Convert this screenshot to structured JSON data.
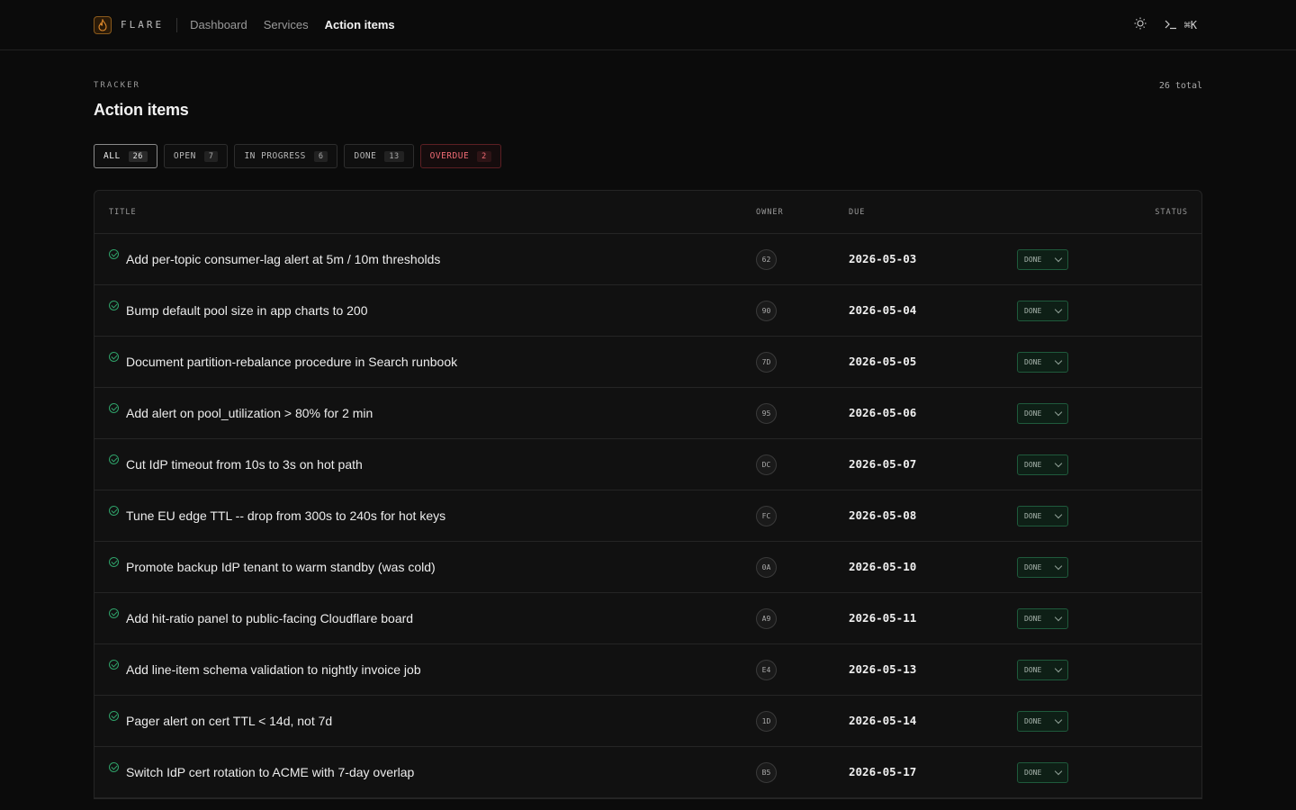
{
  "app": {
    "brand": "FLARE",
    "nav": [
      {
        "label": "Dashboard",
        "active": false
      },
      {
        "label": "Services",
        "active": false
      },
      {
        "label": "Action items",
        "active": true
      }
    ],
    "cmd_hint": "⌘K"
  },
  "header": {
    "kicker": "TRACKER",
    "title": "Action items",
    "total": "26 total"
  },
  "filters": [
    {
      "label": "ALL",
      "count": "26",
      "state": "active"
    },
    {
      "label": "OPEN",
      "count": "7",
      "state": ""
    },
    {
      "label": "IN PROGRESS",
      "count": "6",
      "state": ""
    },
    {
      "label": "DONE",
      "count": "13",
      "state": ""
    },
    {
      "label": "OVERDUE",
      "count": "2",
      "state": "overdue"
    }
  ],
  "table": {
    "columns": {
      "title": "TITLE",
      "owner": "OWNER",
      "due": "DUE",
      "status": "STATUS"
    },
    "rows": [
      {
        "title": "Add per-topic consumer-lag alert at 5m / 10m thresholds",
        "owner": "62",
        "due": "2026-05-03",
        "status": "DONE"
      },
      {
        "title": "Bump default pool size in app charts to 200",
        "owner": "90",
        "due": "2026-05-04",
        "status": "DONE"
      },
      {
        "title": "Document partition-rebalance procedure in Search runbook",
        "owner": "7D",
        "due": "2026-05-05",
        "status": "DONE"
      },
      {
        "title": "Add alert on pool_utilization > 80% for 2 min",
        "owner": "95",
        "due": "2026-05-06",
        "status": "DONE"
      },
      {
        "title": "Cut IdP timeout from 10s to 3s on hot path",
        "owner": "DC",
        "due": "2026-05-07",
        "status": "DONE"
      },
      {
        "title": "Tune EU edge TTL -- drop from 300s to 240s for hot keys",
        "owner": "FC",
        "due": "2026-05-08",
        "status": "DONE"
      },
      {
        "title": "Promote backup IdP tenant to warm standby (was cold)",
        "owner": "0A",
        "due": "2026-05-10",
        "status": "DONE"
      },
      {
        "title": "Add hit-ratio panel to public-facing Cloudflare board",
        "owner": "A9",
        "due": "2026-05-11",
        "status": "DONE"
      },
      {
        "title": "Add line-item schema validation to nightly invoice job",
        "owner": "E4",
        "due": "2026-05-13",
        "status": "DONE"
      },
      {
        "title": "Pager alert on cert TTL < 14d, not 7d",
        "owner": "1D",
        "due": "2026-05-14",
        "status": "DONE"
      },
      {
        "title": "Switch IdP cert rotation to ACME with 7-day overlap",
        "owner": "B5",
        "due": "2026-05-17",
        "status": "DONE"
      }
    ]
  },
  "colors": {
    "accent_done": "#2fa36a",
    "overdue": "#f06b74",
    "background": "#0b0b0b"
  }
}
